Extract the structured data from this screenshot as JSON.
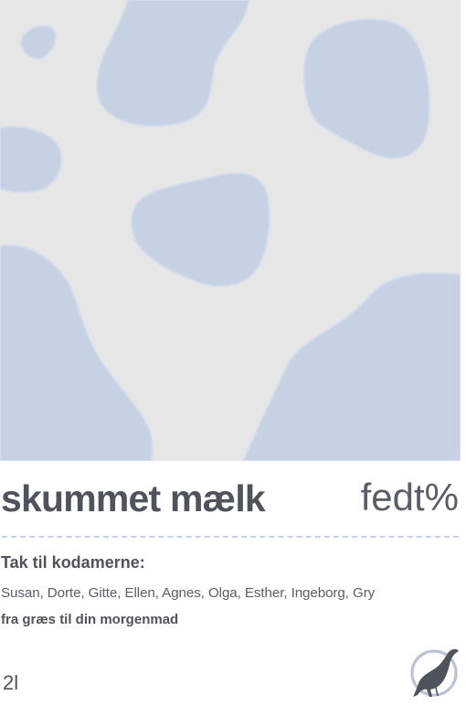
{
  "label": {
    "product_name": "skummet mælk",
    "variant": "fedt%",
    "thanks_heading": "Tak til kodamerne:",
    "names": "Susan, Dorte, Gitte, Ellen, Agnes, Olga, Esther, Ingeborg, Gry",
    "tagline": "fra græs til din morgenmad",
    "volume": "2l"
  },
  "artwork": {
    "motif": "cow-spots",
    "background_color": "#e6e6e6",
    "spot_color": "#c6d1e4"
  },
  "logo": {
    "icon": "bird-icon",
    "color": "#4f535c",
    "ring_color": "#b9c2d6"
  }
}
